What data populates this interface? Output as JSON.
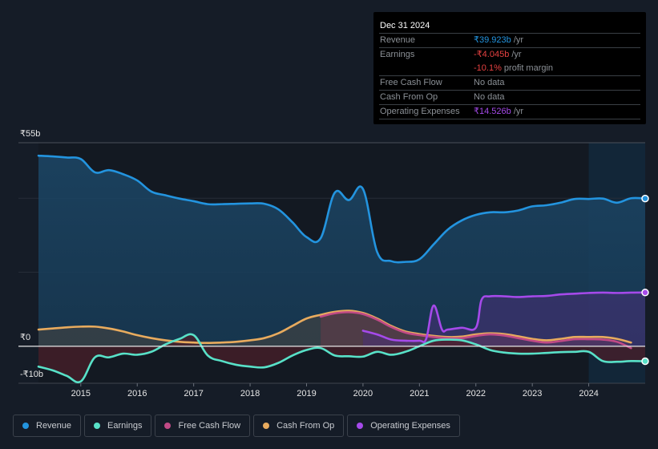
{
  "tooltip": {
    "date": "Dec 31 2024",
    "rows": [
      {
        "label": "Revenue",
        "value": "₹39.923b",
        "unit": " /yr"
      },
      {
        "label": "Earnings",
        "value": "-₹4.045b",
        "unit": " /yr"
      },
      {
        "label": "",
        "value": "-10.1%",
        "unit": " profit margin"
      },
      {
        "label": "Free Cash Flow",
        "value": "No data",
        "unit": ""
      },
      {
        "label": "Cash From Op",
        "value": "No data",
        "unit": ""
      },
      {
        "label": "Operating Expenses",
        "value": "₹14.526b",
        "unit": " /yr"
      }
    ]
  },
  "legend": [
    {
      "label": "Revenue",
      "color": "#2394df"
    },
    {
      "label": "Earnings",
      "color": "#58e1c8"
    },
    {
      "label": "Free Cash Flow",
      "color": "#c14a86"
    },
    {
      "label": "Cash From Op",
      "color": "#e8ab5e"
    },
    {
      "label": "Operating Expenses",
      "color": "#a54aea"
    }
  ],
  "chart_data": {
    "type": "area",
    "currency": "₹",
    "unit": "b",
    "ylim": [
      -10,
      55
    ],
    "xlim": [
      2014.25,
      2025.0
    ],
    "ytick_labels": [
      "₹55b",
      "₹0",
      "-₹10b"
    ],
    "yticks": [
      55,
      0,
      -10
    ],
    "xtick_labels": [
      "2015",
      "2016",
      "2017",
      "2018",
      "2019",
      "2020",
      "2021",
      "2022",
      "2023",
      "2024"
    ],
    "xticks": [
      2015,
      2016,
      2017,
      2018,
      2019,
      2020,
      2021,
      2022,
      2023,
      2024
    ],
    "highlight_from": 2024.0,
    "series": [
      {
        "name": "Revenue",
        "color": "#2394df",
        "x": [
          2014.25,
          2014.5,
          2014.75,
          2015.0,
          2015.25,
          2015.5,
          2015.75,
          2016.0,
          2016.25,
          2016.5,
          2016.75,
          2017.0,
          2017.25,
          2017.5,
          2017.75,
          2018.0,
          2018.25,
          2018.5,
          2018.75,
          2019.0,
          2019.25,
          2019.5,
          2019.75,
          2020.0,
          2020.25,
          2020.5,
          2020.75,
          2021.0,
          2021.25,
          2021.5,
          2021.75,
          2022.0,
          2022.25,
          2022.5,
          2022.75,
          2023.0,
          2023.25,
          2023.5,
          2023.75,
          2024.0,
          2024.25,
          2024.5,
          2024.75,
          2025.0
        ],
        "values": [
          51.5,
          51.3,
          51,
          50.6,
          47,
          47.6,
          46.5,
          44.8,
          41.8,
          40.8,
          39.9,
          39.2,
          38.4,
          38.4,
          38.5,
          38.6,
          38.5,
          37,
          33.5,
          29.5,
          29.2,
          41.5,
          39.5,
          42.5,
          25.5,
          23.0,
          22.8,
          23.5,
          27.5,
          31.5,
          34.0,
          35.5,
          36.2,
          36.2,
          36.7,
          37.8,
          38.1,
          38.8,
          39.8,
          39.8,
          39.9,
          38.8,
          40.0,
          39.923
        ]
      },
      {
        "name": "Earnings",
        "color": "#58e1c8",
        "x": [
          2014.25,
          2014.5,
          2014.75,
          2015.0,
          2015.25,
          2015.5,
          2015.75,
          2016.0,
          2016.25,
          2016.5,
          2016.75,
          2017.0,
          2017.25,
          2017.5,
          2017.75,
          2018.0,
          2018.25,
          2018.5,
          2018.75,
          2019.0,
          2019.25,
          2019.5,
          2019.75,
          2020.0,
          2020.25,
          2020.5,
          2020.75,
          2021.0,
          2021.25,
          2021.5,
          2021.75,
          2022.0,
          2022.25,
          2022.5,
          2022.75,
          2023.0,
          2023.25,
          2023.5,
          2023.75,
          2024.0,
          2024.25,
          2024.5,
          2024.75,
          2025.0
        ],
        "values": [
          -5.5,
          -6.5,
          -8.0,
          -9.5,
          -3.0,
          -3.0,
          -2.0,
          -2.3,
          -1.5,
          0.5,
          2.0,
          3.0,
          -2.5,
          -4.0,
          -5.0,
          -5.5,
          -5.7,
          -4.5,
          -2.5,
          -1.0,
          -0.5,
          -2.5,
          -2.7,
          -2.8,
          -1.5,
          -2.3,
          -1.5,
          0.0,
          1.5,
          1.8,
          1.6,
          0.5,
          -1.0,
          -1.7,
          -2.0,
          -2.0,
          -1.8,
          -1.6,
          -1.5,
          -1.5,
          -4.0,
          -4.2,
          -4.0,
          -4.045
        ]
      },
      {
        "name": "Cash From Op",
        "color": "#e8ab5e",
        "x": [
          2014.25,
          2014.5,
          2014.75,
          2015.0,
          2015.25,
          2015.5,
          2015.75,
          2016.0,
          2016.25,
          2016.5,
          2016.75,
          2017.0,
          2017.25,
          2017.5,
          2017.75,
          2018.0,
          2018.25,
          2018.5,
          2018.75,
          2019.0,
          2019.25,
          2019.5,
          2019.75,
          2020.0,
          2020.25,
          2020.5,
          2020.75,
          2021.0,
          2021.25,
          2021.5,
          2021.75,
          2022.0,
          2022.25,
          2022.5,
          2022.75,
          2023.0,
          2023.25,
          2023.5,
          2023.75,
          2024.0,
          2024.25,
          2024.5,
          2024.75
        ],
        "values": [
          4.5,
          4.8,
          5.1,
          5.3,
          5.3,
          4.8,
          4.0,
          3.0,
          2.2,
          1.6,
          1.2,
          1.0,
          0.9,
          1.0,
          1.2,
          1.6,
          2.2,
          3.5,
          5.5,
          7.5,
          8.5,
          9.3,
          9.6,
          9.0,
          7.5,
          5.5,
          4.0,
          3.3,
          2.8,
          2.5,
          2.6,
          3.2,
          3.5,
          3.3,
          2.7,
          2.0,
          1.6,
          2.0,
          2.5,
          2.5,
          2.5,
          2.0,
          1.0
        ]
      },
      {
        "name": "Free Cash Flow",
        "color": "#c14a86",
        "x": [
          2019.25,
          2019.5,
          2019.75,
          2020.0,
          2020.25,
          2020.5,
          2020.75,
          2021.0,
          2021.25,
          2021.5,
          2021.75,
          2022.0,
          2022.25,
          2022.5,
          2022.75,
          2023.0,
          2023.25,
          2023.5,
          2023.75,
          2024.0,
          2024.25,
          2024.5,
          2024.75
        ],
        "values": [
          8.0,
          8.9,
          9.2,
          8.7,
          7.2,
          5.2,
          3.7,
          3.0,
          2.5,
          2.2,
          2.2,
          2.8,
          3.2,
          2.9,
          2.2,
          1.5,
          1.0,
          1.4,
          1.9,
          1.9,
          1.8,
          1.2,
          -0.5
        ]
      },
      {
        "name": "Operating Expenses",
        "color": "#a54aea",
        "x": [
          2020.0,
          2020.25,
          2020.5,
          2020.75,
          2021.0,
          2021.12,
          2021.25,
          2021.4,
          2021.5,
          2021.75,
          2022.0,
          2022.1,
          2022.25,
          2022.5,
          2022.75,
          2023.0,
          2023.25,
          2023.5,
          2023.75,
          2024.0,
          2024.25,
          2024.5,
          2024.75,
          2025.0
        ],
        "values": [
          4.2,
          3.2,
          1.8,
          1.5,
          1.5,
          2.0,
          11.0,
          4.5,
          4.5,
          5.0,
          5.0,
          12.5,
          13.5,
          13.5,
          13.3,
          13.5,
          13.6,
          14.0,
          14.2,
          14.4,
          14.5,
          14.4,
          14.5,
          14.526
        ]
      }
    ]
  }
}
